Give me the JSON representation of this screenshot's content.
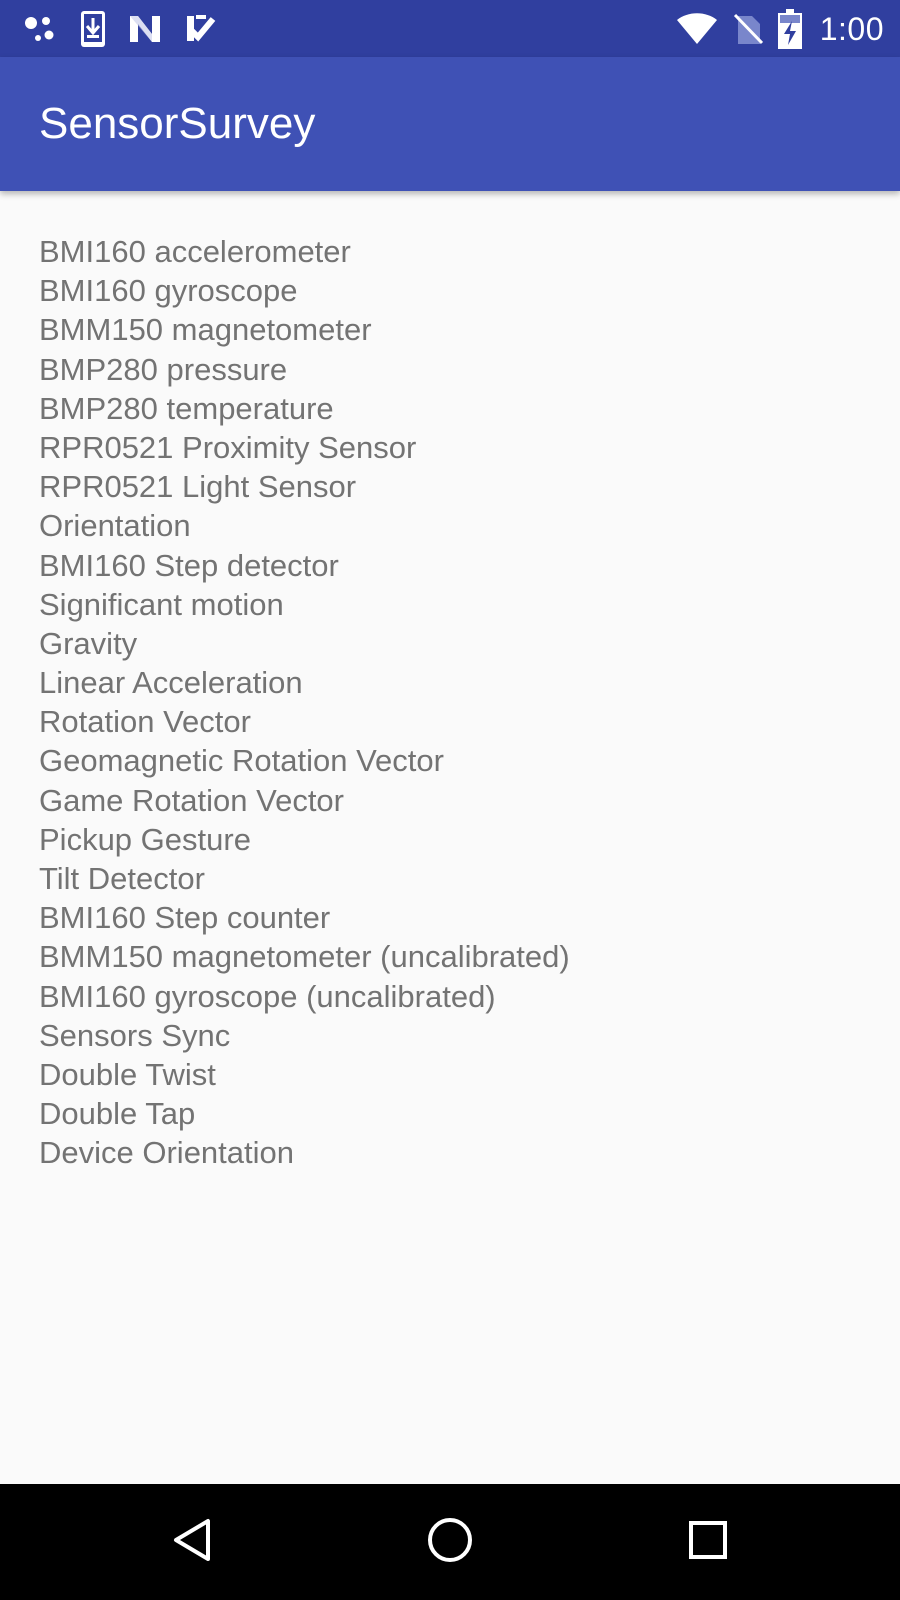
{
  "status_bar": {
    "time": "1:00",
    "left_icons": [
      "assistant-dots-icon",
      "download-icon",
      "n-logo-icon",
      "check-app-icon"
    ],
    "right_icons": [
      "wifi-icon",
      "no-sim-icon",
      "battery-charging-icon"
    ]
  },
  "app_bar": {
    "title": "SensorSurvey",
    "color": "#3f51b5",
    "status_color": "#303f9f"
  },
  "sensors": [
    "BMI160 accelerometer",
    "BMI160 gyroscope",
    "BMM150 magnetometer",
    "BMP280 pressure",
    "BMP280 temperature",
    "RPR0521 Proximity Sensor",
    "RPR0521 Light Sensor",
    "Orientation",
    "BMI160 Step detector",
    "Significant motion",
    "Gravity",
    "Linear Acceleration",
    "Rotation Vector",
    "Geomagnetic Rotation Vector",
    "Game Rotation Vector",
    "Pickup Gesture",
    "Tilt Detector",
    "BMI160 Step counter",
    "BMM150 magnetometer (uncalibrated)",
    "BMI160 gyroscope (uncalibrated)",
    "Sensors Sync",
    "Double Twist",
    "Double Tap",
    "Device Orientation"
  ],
  "nav_bar": {
    "buttons": [
      "back-icon",
      "home-icon",
      "recents-icon"
    ]
  }
}
